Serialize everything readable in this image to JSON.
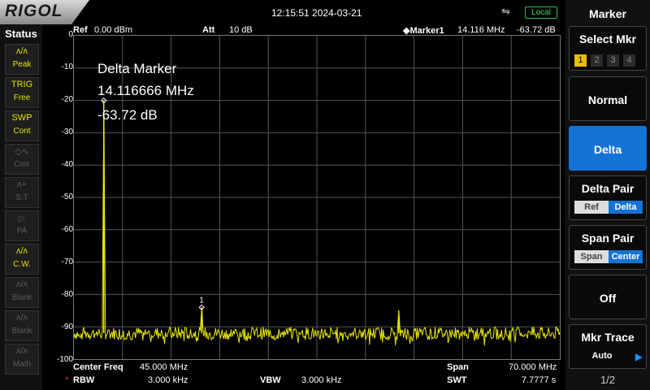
{
  "brand": "RIGOL",
  "datetime": "12:15:51  2024-03-21",
  "usb_glyph": "⇋",
  "local_label": "Local",
  "status": {
    "title": "Status",
    "items": [
      {
        "icon": "peak-icon",
        "glyph": "ʌ/ʌ",
        "label": "Peak",
        "active": true
      },
      {
        "icon": "trig-icon",
        "glyph": "TRIG",
        "label": "Free",
        "active": true
      },
      {
        "icon": "sweep-icon",
        "glyph": "SWP",
        "label": "Cont",
        "active": true
      },
      {
        "icon": "corr-icon",
        "glyph": "◇∿",
        "label": "Corr",
        "active": false
      },
      {
        "icon": "st-icon",
        "glyph": "ʌ+",
        "label": "S.T",
        "active": false
      },
      {
        "icon": "pa-icon",
        "glyph": "▷",
        "label": "PA",
        "active": false
      },
      {
        "icon": "cw-icon",
        "glyph": "ʌ/ʌ",
        "label": "C.W.",
        "active": true
      },
      {
        "icon": "blank-icon",
        "glyph": "ʌ/ʌ",
        "label": "Blank",
        "active": false
      },
      {
        "icon": "blank-icon",
        "glyph": "ʌ/ʌ",
        "label": "Blank",
        "active": false
      },
      {
        "icon": "math-icon",
        "glyph": "ʌ/ʌ",
        "label": "Math",
        "active": false
      }
    ]
  },
  "header": {
    "ref_label": "Ref",
    "ref_value": "0.00 dBm",
    "att_label": "Att",
    "att_value": "10 dB",
    "marker_label": "◆Marker1",
    "marker_freq": "14.116 MHz",
    "marker_amp": "-63.72 dB"
  },
  "annotation": {
    "title": "Delta Marker",
    "freq": "14.116666 MHz",
    "amp": "-63.72 dB"
  },
  "marker_label": "1",
  "footer": {
    "center_label": "Center Freq",
    "center_value": "45.000 MHz",
    "span_label": "Span",
    "span_value": "70.000 MHz",
    "rbw_mark": "*",
    "rbw_label": "RBW",
    "rbw_value": "3.000 kHz",
    "vbw_label": "VBW",
    "vbw_value": "3.000 kHz",
    "swt_label": "SWT",
    "swt_value": "7.7777 s"
  },
  "chart_data": {
    "type": "line",
    "ylim": [
      -100,
      0
    ],
    "xlim": [
      10,
      80
    ],
    "x_unit": "MHz",
    "y_ticks": [
      "0",
      "-10",
      "-20",
      "-30",
      "-40",
      "-50",
      "-60",
      "-70",
      "-80",
      "-90",
      "-100"
    ],
    "noise_floor_db": -92,
    "trace_color": "#e8e800",
    "peaks": [
      {
        "x": 14.3,
        "y": -20
      },
      {
        "x": 28.4,
        "y": -84
      },
      {
        "x": 56.8,
        "y": -85
      }
    ],
    "marker1": {
      "x": 28.4,
      "y": -84
    }
  },
  "menu": {
    "title": "Marker",
    "select_label": "Select Mkr",
    "select_nums": [
      "1",
      "2",
      "3",
      "4"
    ],
    "normal": "Normal",
    "delta": "Delta",
    "delta_pair": "Delta Pair",
    "delta_pair_ref": "Ref",
    "delta_pair_delta": "Delta",
    "span_pair": "Span Pair",
    "span_pair_span": "Span",
    "span_pair_center": "Center",
    "off": "Off",
    "mkr_trace": "Mkr Trace",
    "mkr_trace_value": "Auto",
    "page": "1/2"
  }
}
